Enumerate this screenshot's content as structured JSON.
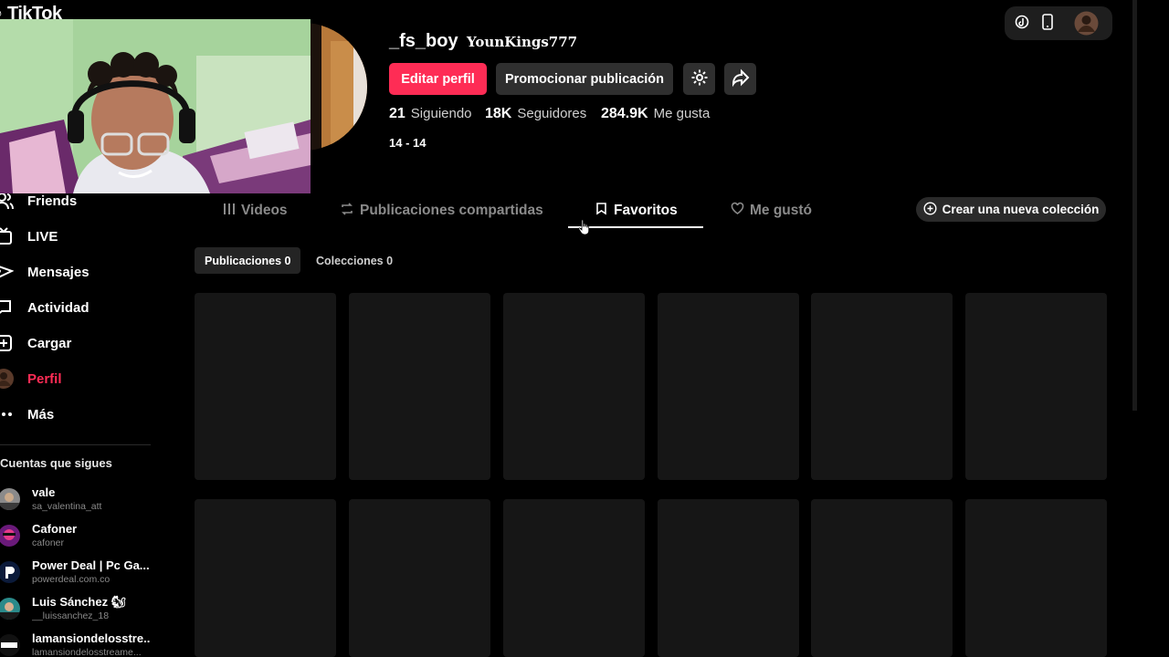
{
  "app": {
    "logo_text": "TikTok"
  },
  "sidebar": {
    "items": [
      {
        "label": "Friends",
        "icon": "friends-icon"
      },
      {
        "label": "LIVE",
        "icon": "live-icon"
      },
      {
        "label": "Mensajes",
        "icon": "messages-icon"
      },
      {
        "label": "Actividad",
        "icon": "activity-icon"
      },
      {
        "label": "Cargar",
        "icon": "upload-icon"
      },
      {
        "label": "Perfil",
        "icon": "profile-avatar-icon",
        "active": true
      },
      {
        "label": "Más",
        "icon": "more-icon"
      }
    ],
    "following_title": "Cuentas que sigues",
    "accounts": [
      {
        "name": "vale",
        "handle": "sa_valentina_att"
      },
      {
        "name": "Cafoner",
        "handle": "cafoner"
      },
      {
        "name": "Power Deal | Pc Ga...",
        "handle": "powerdeal.com.co"
      },
      {
        "name": "Luis Sánchez 🐿",
        "handle": "__luissanchez_18"
      },
      {
        "name": "lamansiondelosstre...",
        "handle": "lamansiondelosstreame..."
      }
    ]
  },
  "profile": {
    "username": "_fs_boy",
    "nickname": "YounKings777",
    "edit_button": "Editar perfil",
    "promote_button": "Promocionar publicación",
    "stats": [
      {
        "value": "21",
        "label": "Siguiendo"
      },
      {
        "value": "18K",
        "label": "Seguidores"
      },
      {
        "value": "284.9K",
        "label": "Me gusta"
      }
    ],
    "bio": "14 - 14"
  },
  "tabs": [
    {
      "label": "Videos",
      "icon": "grid-icon"
    },
    {
      "label": "Publicaciones compartidas",
      "icon": "repost-icon"
    },
    {
      "label": "Favoritos",
      "icon": "bookmark-icon",
      "active": true
    },
    {
      "label": "Me gustó",
      "icon": "heart-icon"
    }
  ],
  "new_collection_button": "Crear una nueva colección",
  "subtabs": [
    {
      "label": "Publicaciones 0",
      "active": true
    },
    {
      "label": "Colecciones 0"
    }
  ],
  "colors": {
    "accent": "#fe2c55",
    "background": "#000000",
    "placeholder": "#161616"
  }
}
